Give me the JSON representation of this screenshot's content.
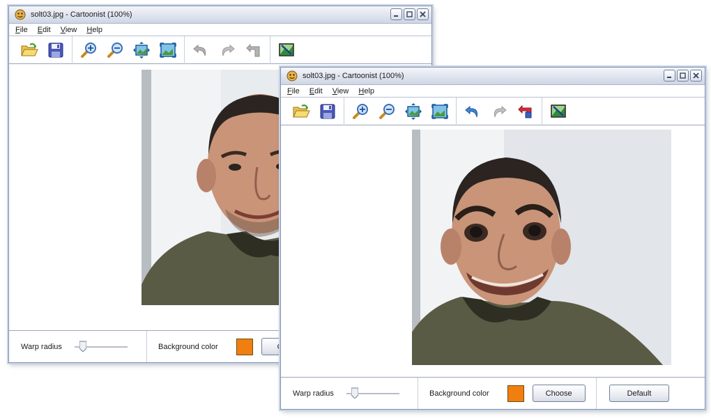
{
  "back_window": {
    "title": "solt03.jpg - Cartoonist (100%)",
    "menu": [
      "File",
      "Edit",
      "View",
      "Help"
    ],
    "toolbar_state": "undo-disabled",
    "bottom": {
      "warp_radius_label": "Warp radius",
      "warp_radius_value": 0.1,
      "background_color_label": "Background color",
      "background_color": "#f07f0f",
      "choose_label": "Ch"
    }
  },
  "front_window": {
    "title": "solt03.jpg - Cartoonist (100%)",
    "menu": [
      "File",
      "Edit",
      "View",
      "Help"
    ],
    "toolbar_state": "undo-enabled",
    "bottom": {
      "warp_radius_label": "Warp radius",
      "warp_radius_value": 0.1,
      "background_color_label": "Background color",
      "background_color": "#f07f0f",
      "choose_label": "Choose",
      "default_label": "Default"
    }
  },
  "toolbar_icons": [
    "open-folder-icon",
    "save-disk-icon",
    "zoom-in-icon",
    "zoom-out-icon",
    "fit-to-window-icon",
    "actual-size-icon",
    "undo-icon",
    "redo-icon",
    "reset-icon",
    "edit-image-icon"
  ],
  "colors": {
    "title_gradient_top": "#f4f6fa",
    "title_gradient_bottom": "#cfd6e4",
    "window_border": "#7f93b4"
  }
}
